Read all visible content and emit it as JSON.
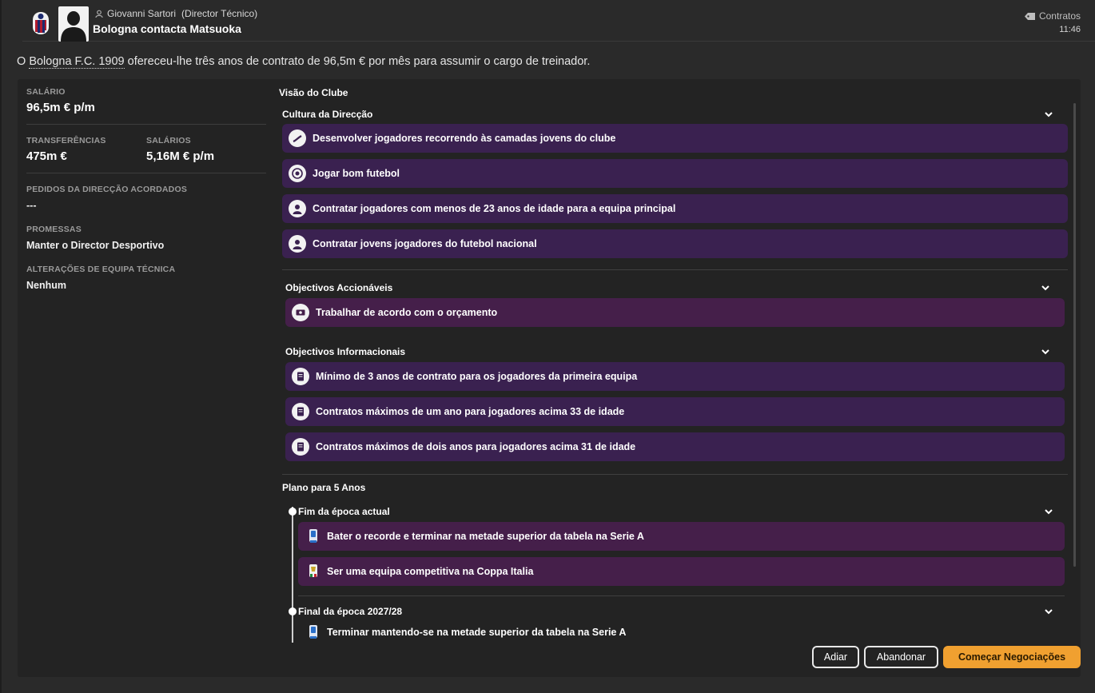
{
  "header": {
    "sender_name": "Giovanni Sartori",
    "sender_role": "(Director Técnico)",
    "headline": "Bologna contacta Matsuoka",
    "category": "Contratos",
    "time": "11:46"
  },
  "intro": {
    "prefix": "O ",
    "club": "Bologna F.C. 1909",
    "suffix": " ofereceu-lhe três anos de contrato de 96,5m € por mês para assumir o cargo de treinador."
  },
  "summary": {
    "salary_label": "SALÁRIO",
    "salary_value": "96,5m € p/m",
    "transfers_label": "TRANSFERÊNCIAS",
    "transfers_value": "475m €",
    "wages_label": "SALÁRIOS",
    "wages_value": "5,16M € p/m",
    "requests_label": "PEDIDOS DA DIRECÇÃO ACORDADOS",
    "requests_value": "---",
    "promises_label": "PROMESSAS",
    "promises_value": "Manter o Director Desportivo",
    "staff_label": "ALTERAÇÕES DE EQUIPA TÉCNICA",
    "staff_value": "Nenhum"
  },
  "vision": {
    "title": "Visão do Clube",
    "culture": {
      "title": "Cultura da Direcção",
      "items": [
        {
          "label": "Desenvolver jogadores recorrendo às camadas jovens do clube",
          "icon": "growth-icon"
        },
        {
          "label": "Jogar bom futebol",
          "icon": "ball-icon"
        },
        {
          "label": "Contratar jogadores com menos de 23 anos de idade para a equipa principal",
          "icon": "player-icon"
        },
        {
          "label": "Contratar jovens jogadores do futebol nacional",
          "icon": "player-icon"
        }
      ]
    },
    "actionable": {
      "title": "Objectivos Accionáveis",
      "items": [
        {
          "label": "Trabalhar de acordo com o orçamento",
          "icon": "budget-icon"
        }
      ]
    },
    "informational": {
      "title": "Objectivos Informacionais",
      "items": [
        {
          "label": "Mínimo de 3 anos de contrato para os jogadores da primeira equipa",
          "icon": "document-icon"
        },
        {
          "label": "Contratos máximos de um ano para jogadores acima 33 de idade",
          "icon": "document-icon"
        },
        {
          "label": "Contratos máximos de dois anos para jogadores acima 31 de idade",
          "icon": "document-icon"
        }
      ]
    },
    "plan": {
      "title": "Plano para 5 Anos",
      "stages": [
        {
          "title": "Fim da época actual",
          "items": [
            {
              "label": "Bater o recorde e terminar na metade superior da tabela na Serie A",
              "icon": "serie-a-icon"
            },
            {
              "label": "Ser uma equipa competitiva na Coppa Italia",
              "icon": "coppa-italia-icon"
            }
          ]
        },
        {
          "title": "Final da época 2027/28",
          "items": [
            {
              "label": "Terminar mantendo-se na metade superior da tabela na Serie A",
              "icon": "serie-a-icon"
            }
          ]
        }
      ]
    }
  },
  "buttons": {
    "delay": "Adiar",
    "abandon": "Abandonar",
    "start": "Começar Negociações"
  },
  "colors": {
    "accent": "#f0a030",
    "culture_item_bg": "#3a2150",
    "highlight_item_bg": "#451f4a",
    "panel_bg": "#232323"
  }
}
